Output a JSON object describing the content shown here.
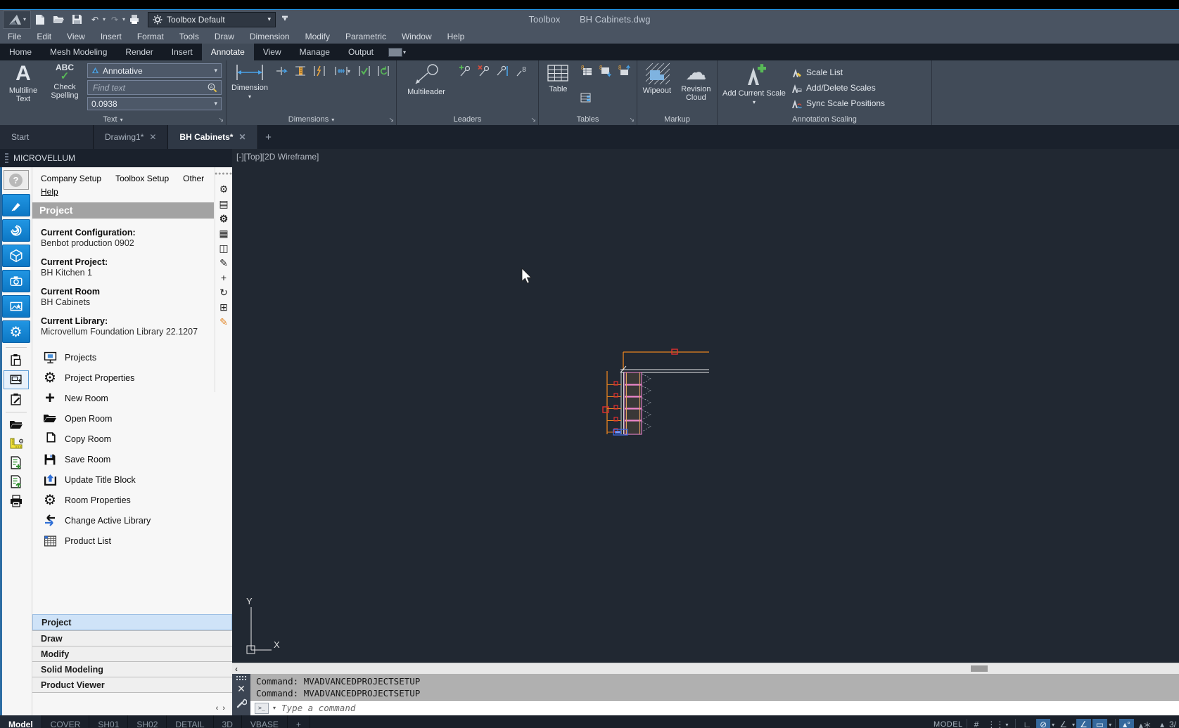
{
  "titlebar": {
    "workspace_combo": "Toolbox Default",
    "title_app": "Toolbox",
    "title_doc": "BH Cabinets.dwg"
  },
  "menubar": {
    "items": [
      "File",
      "Edit",
      "View",
      "Insert",
      "Format",
      "Tools",
      "Draw",
      "Dimension",
      "Modify",
      "Parametric",
      "Window",
      "Help"
    ]
  },
  "ribbon": {
    "tabs": [
      "Home",
      "Mesh Modeling",
      "Render",
      "Insert",
      "Annotate",
      "View",
      "Manage",
      "Output"
    ],
    "active_tab": "Annotate",
    "text_panel": {
      "title": "Text",
      "multiline": "Multiline\nText",
      "check_spelling": "Check\nSpelling",
      "style_combo": "Annotative",
      "find_placeholder": "Find text",
      "height_combo": "0.0938"
    },
    "dims_panel": {
      "title": "Dimensions",
      "big": "Dimension"
    },
    "leaders_panel": {
      "title": "Leaders",
      "big": "Multileader"
    },
    "tables_panel": {
      "title": "Tables",
      "big": "Table"
    },
    "markup_panel": {
      "title": "Markup",
      "wipeout": "Wipeout",
      "revcloud": "Revision\nCloud"
    },
    "ascale_panel": {
      "title": "Annotation Scaling",
      "big": "Add Current Scale",
      "items": [
        "Scale List",
        "Add/Delete Scales",
        "Sync Scale Positions"
      ]
    }
  },
  "doctabs": {
    "tabs": [
      "Start",
      "Drawing1*",
      "BH Cabinets*"
    ],
    "active": "BH Cabinets*",
    "add": "+"
  },
  "palette": {
    "title": "MICROVELLUM",
    "menu": [
      "Company Setup",
      "Toolbox Setup",
      "Other",
      "Help"
    ],
    "section_header": "Project",
    "info": [
      {
        "label": "Current Configuration:",
        "value": "Benbot production 0902"
      },
      {
        "label": "Current Project:",
        "value": "BH Kitchen 1"
      },
      {
        "label": "Current Room",
        "value": "BH Cabinets"
      },
      {
        "label": "Current Library:",
        "value": "Microvellum Foundation Library 22.1207"
      }
    ],
    "actions": [
      "Projects",
      "Project Properties",
      "New Room",
      "Open Room",
      "Copy Room",
      "Save Room",
      "Update Title Block",
      "Room Properties",
      "Change Active Library",
      "Product List"
    ],
    "accordion": [
      "Project",
      "Draw",
      "Modify",
      "Solid Modeling",
      "Product Viewer"
    ],
    "accordion_active": "Project"
  },
  "canvas": {
    "viewport_label": "[-][Top][2D Wireframe]",
    "ucs_x": "X",
    "ucs_y": "Y"
  },
  "command": {
    "line1": "Command: MVADVANCEDPROJECTSETUP",
    "line2": "Command: MVADVANCEDPROJECTSETUP",
    "prompt_placeholder": "Type a command"
  },
  "statusbar": {
    "layouts": [
      "Model",
      "COVER",
      "SH01",
      "SH02",
      "DETAIL",
      "3D",
      "VBASE"
    ],
    "active_layout": "Model",
    "add": "+",
    "mode_label": "MODEL",
    "scale_partial": "3/"
  },
  "colors": {
    "accent_blue": "#1e90e0",
    "canvas_bg": "#212832",
    "ribbon_bg": "#414b58",
    "palette_blue_button": "#1389dc",
    "drawing_orange": "#e8831f",
    "drawing_pink": "#ef86cc",
    "drawing_red": "#e23030",
    "drawing_blue": "#3f68e0"
  }
}
